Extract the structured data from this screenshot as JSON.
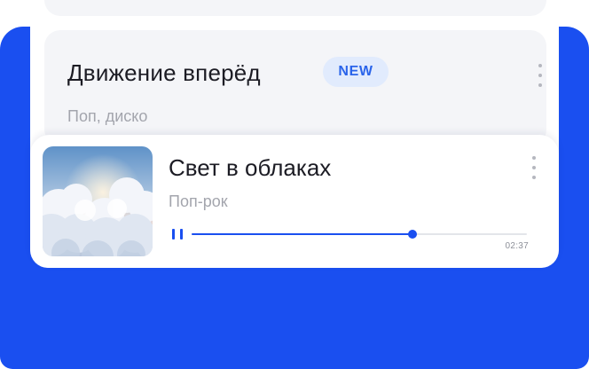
{
  "colors": {
    "accent": "#1a4ff0",
    "badge_background": "#e1ebfd",
    "badge_text": "#2a64ea",
    "card_background": "#f4f5f8"
  },
  "list_item": {
    "title": "Движение вперёд",
    "badge": "NEW",
    "genre": "Поп, диско",
    "menu_icon": "more-vertical-icon"
  },
  "player": {
    "title": "Свет в облаках",
    "genre": "Поп-рок",
    "time": "02:37",
    "progress": 0.66,
    "play_state_icon": "pause-icon",
    "menu_icon": "more-vertical-icon",
    "cover_art": "clouds-sky-image"
  }
}
